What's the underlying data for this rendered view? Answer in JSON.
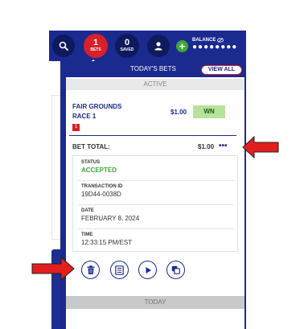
{
  "nav": {
    "bets_count": "1",
    "bets_label": "BETS",
    "saved_count": "0",
    "saved_label": "SAVED",
    "balance_label": "BALANCE",
    "balance_value": "●●●●●●●●"
  },
  "panel": {
    "title": "TODAY'S BETS",
    "view_all": "VIEW ALL",
    "section_active": "ACTIVE",
    "section_today": "TODAY"
  },
  "bet": {
    "track": "FAIR GROUNDS",
    "race": "RACE 1",
    "selection": "1",
    "amount": "$1.00",
    "wager_type": "WN",
    "total_label": "BET TOTAL:",
    "total_value": "$1.00"
  },
  "details": [
    {
      "label": "STATUS",
      "value": "ACCEPTED"
    },
    {
      "label": "TRANSACTION ID",
      "value": "19D44-0038D"
    },
    {
      "label": "DATE",
      "value": "FEBRUARY 8, 2024"
    },
    {
      "label": "TIME",
      "value": "12:33:15 PM/EST"
    }
  ],
  "actions": [
    "trash-icon",
    "receipt-icon",
    "play-icon",
    "copy-icon"
  ],
  "colors": {
    "brand_blue": "#1b2a8f",
    "alert_red": "#d8202a",
    "success_green": "#3fa83a",
    "wager_chip": "#b7e29a"
  }
}
